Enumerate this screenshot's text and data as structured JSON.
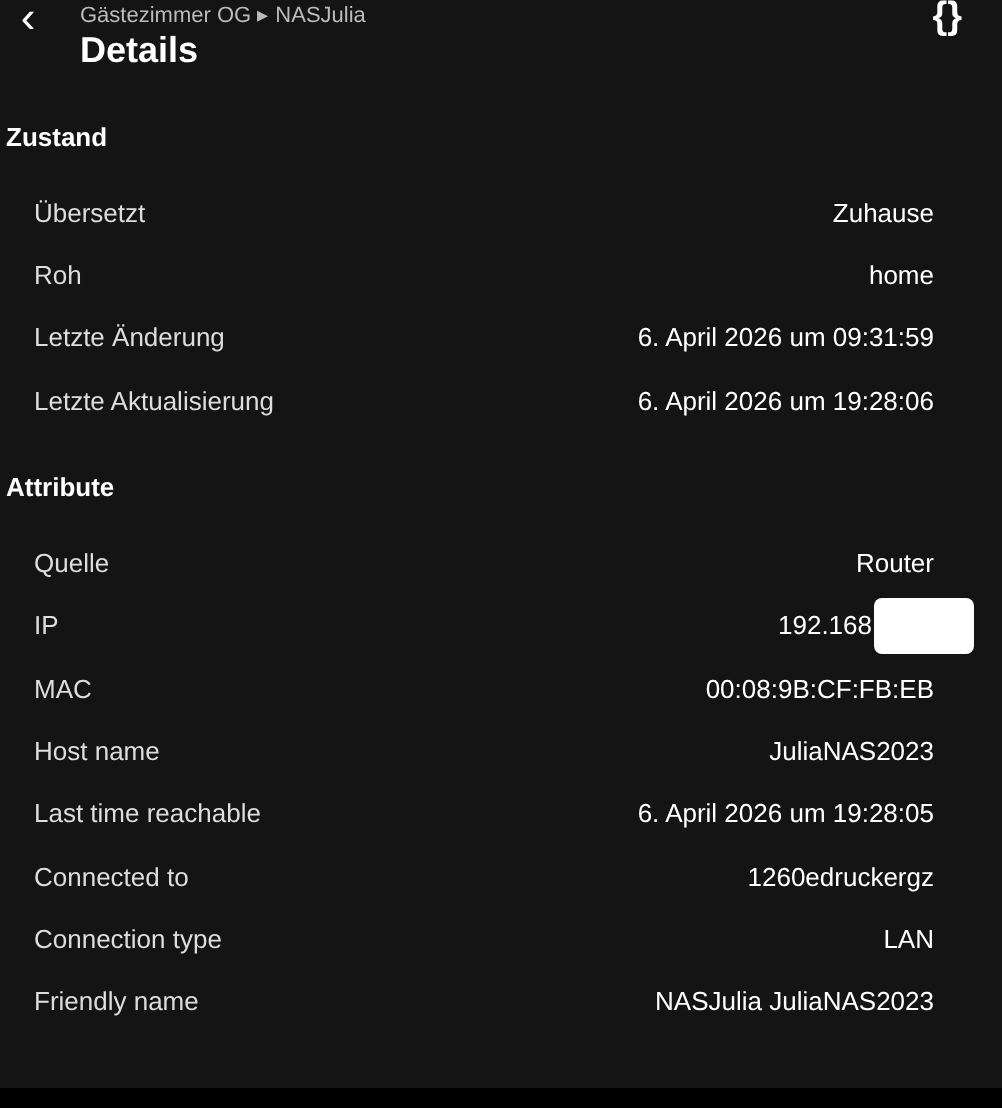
{
  "header": {
    "breadcrumb": "Gästezimmer OG ▸ NASJulia",
    "title": "Details",
    "back_icon": "‹",
    "json_icon": "{}"
  },
  "sections": [
    {
      "title": "Zustand",
      "rows": [
        {
          "label": "Übersetzt",
          "value": "Zuhause"
        },
        {
          "label": "Roh",
          "value": "home"
        },
        {
          "label": "Letzte Änderung",
          "value": "6. April 2026 um 09:31:59"
        },
        {
          "label": "Letzte Aktualisierung",
          "value": "6. April 2026 um 19:28:06"
        }
      ]
    },
    {
      "title": "Attribute",
      "rows": [
        {
          "label": "Quelle",
          "value": "Router"
        },
        {
          "label": "IP",
          "value": "192.168",
          "redacted": true
        },
        {
          "label": "MAC",
          "value": "00:08:9B:CF:FB:EB"
        },
        {
          "label": "Host name",
          "value": "JuliaNAS2023"
        },
        {
          "label": "Last time reachable",
          "value": "6. April 2026 um 19:28:05"
        },
        {
          "label": "Connected to",
          "value": "1260edruckergz"
        },
        {
          "label": "Connection type",
          "value": "LAN"
        },
        {
          "label": "Friendly name",
          "value": "NASJulia JuliaNAS2023"
        }
      ]
    }
  ]
}
